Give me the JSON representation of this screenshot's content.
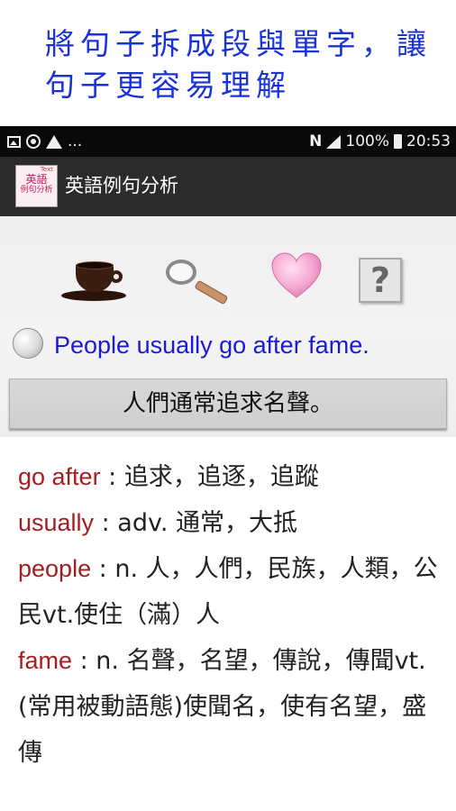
{
  "banner": {
    "text": "將句子拆成段與單字，讓句子更容易理解"
  },
  "status_bar": {
    "left_icons": [
      "image-icon",
      "sync-icon",
      "warning-icon"
    ],
    "more": "...",
    "nfc": "N",
    "battery": "100%",
    "time": "20:53"
  },
  "app_bar": {
    "logo_top": "Text",
    "logo_main": "英語",
    "logo_sub": "例句分析",
    "title": "英語例句分析"
  },
  "toolbar": {
    "icons": [
      "coffee-cup-icon",
      "magnifier-icon",
      "heart-icon",
      "help-icon"
    ]
  },
  "sentence": {
    "text": "People usually go after fame.",
    "translation": "人們通常追求名聲。"
  },
  "definitions": [
    {
      "word": "go after",
      "meaning": " : 追求，追逐，追蹤"
    },
    {
      "word": "usually",
      "meaning": " : adv. 通常，大抵"
    },
    {
      "word": "people",
      "meaning": " : n. 人，人們，民族，人類，公民vt.使住（滿）人"
    },
    {
      "word": "fame",
      "meaning": " : n. 名聲，名望，傳說，傳聞vt.(常用被動語態)使聞名，使有名望，盛傳"
    }
  ],
  "colors": {
    "banner_text": "#1a33d6",
    "sentence_text": "#1a1ad6",
    "word_text": "#a31f1f",
    "app_bar": "#2b2b2b",
    "status_bar": "#0a0a0a"
  }
}
